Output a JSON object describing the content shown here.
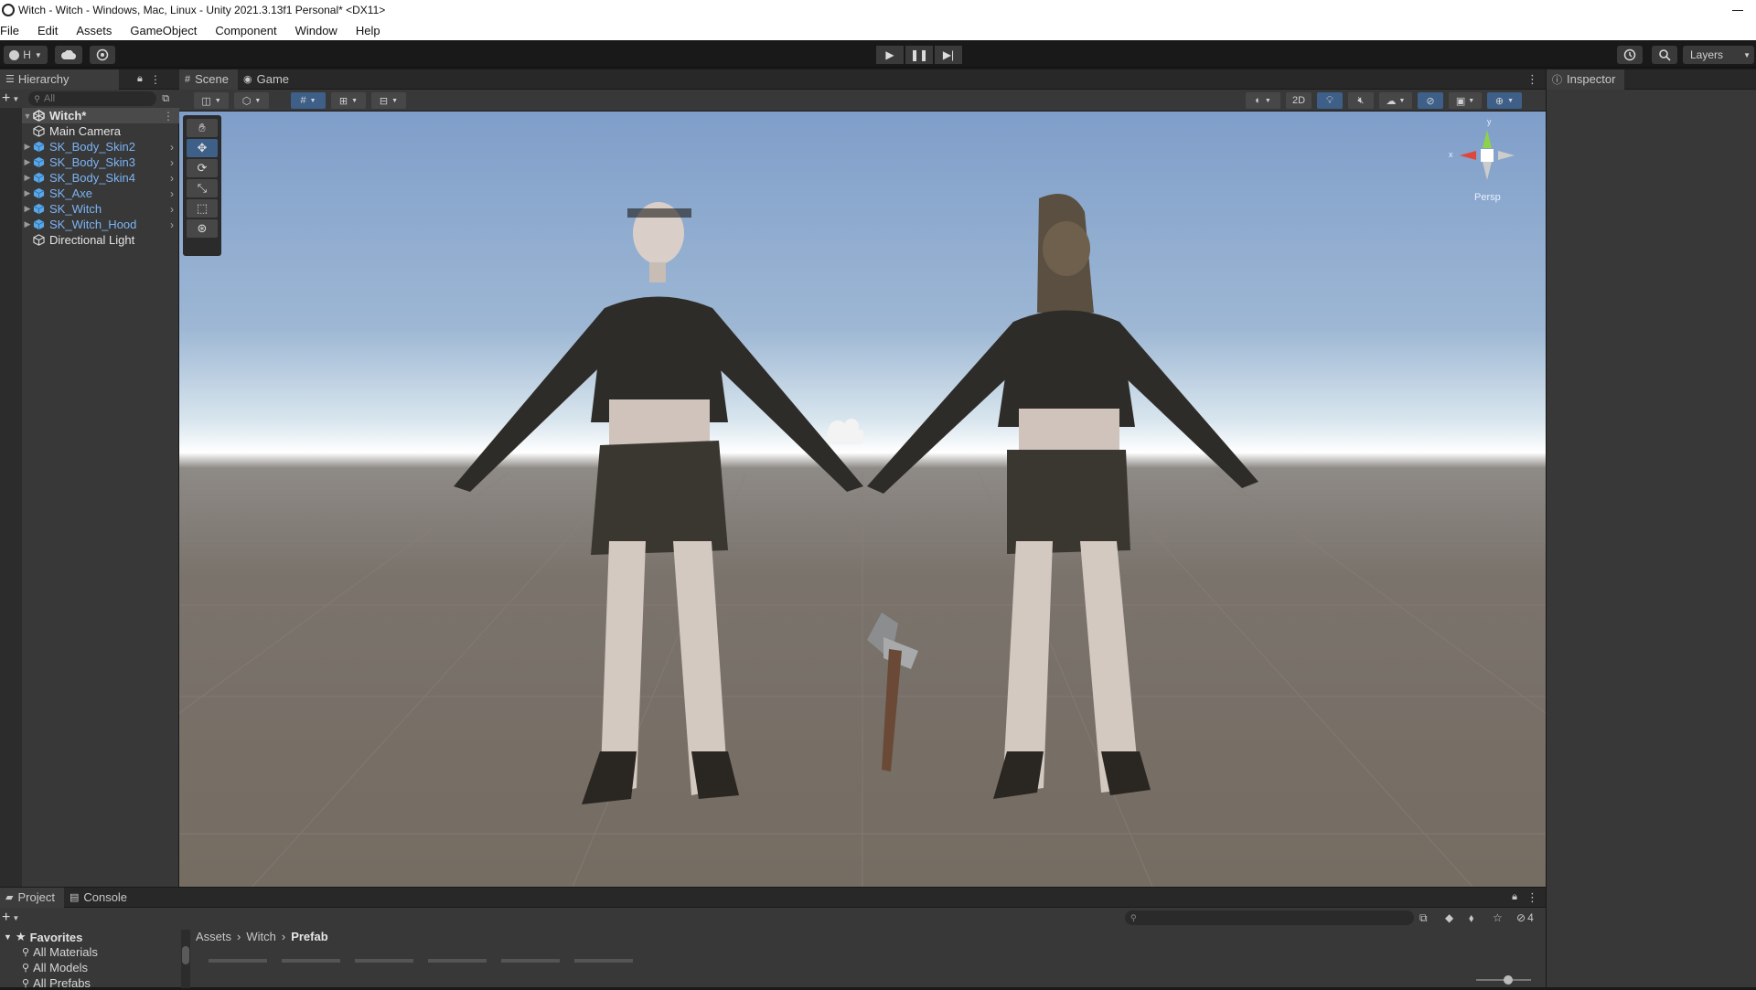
{
  "window": {
    "title": "Witch - Witch - Windows, Mac, Linux - Unity 2021.3.13f1 Personal* <DX11>"
  },
  "menu": [
    "File",
    "Edit",
    "Assets",
    "GameObject",
    "Component",
    "Window",
    "Help"
  ],
  "toolbar": {
    "account_label": "H",
    "layers_label": "Layers"
  },
  "hierarchy": {
    "tab_label": "Hierarchy",
    "search_placeholder": "All",
    "scene_name": "Witch*",
    "items": [
      {
        "label": "Main Camera",
        "prefab": false
      },
      {
        "label": "SK_Body_Skin2",
        "prefab": true
      },
      {
        "label": "SK_Body_Skin3",
        "prefab": true
      },
      {
        "label": "SK_Body_Skin4",
        "prefab": true
      },
      {
        "label": "SK_Axe",
        "prefab": true
      },
      {
        "label": "SK_Witch",
        "prefab": true
      },
      {
        "label": "SK_Witch_Hood",
        "prefab": true
      },
      {
        "label": "Directional Light",
        "prefab": false
      }
    ]
  },
  "scene": {
    "tabs": [
      {
        "label": "Scene",
        "active": true
      },
      {
        "label": "Game",
        "active": false
      }
    ],
    "toggle_2d": "2D",
    "gizmo_persp": "Persp",
    "gizmo_axis_y": "y",
    "gizmo_axis_x": "x"
  },
  "inspector": {
    "tab_label": "Inspector"
  },
  "project": {
    "tabs": [
      {
        "label": "Project",
        "active": true
      },
      {
        "label": "Console",
        "active": false
      }
    ],
    "favorites_label": "Favorites",
    "favorites": [
      "All Materials",
      "All Models",
      "All Prefabs"
    ],
    "breadcrumb": [
      "Assets",
      "Witch",
      "Prefab"
    ],
    "hidden_count": "4"
  },
  "colors": {
    "prefab_text": "#7cb4f5",
    "accent_button": "#3d5f88",
    "panel_bg": "#383838"
  }
}
